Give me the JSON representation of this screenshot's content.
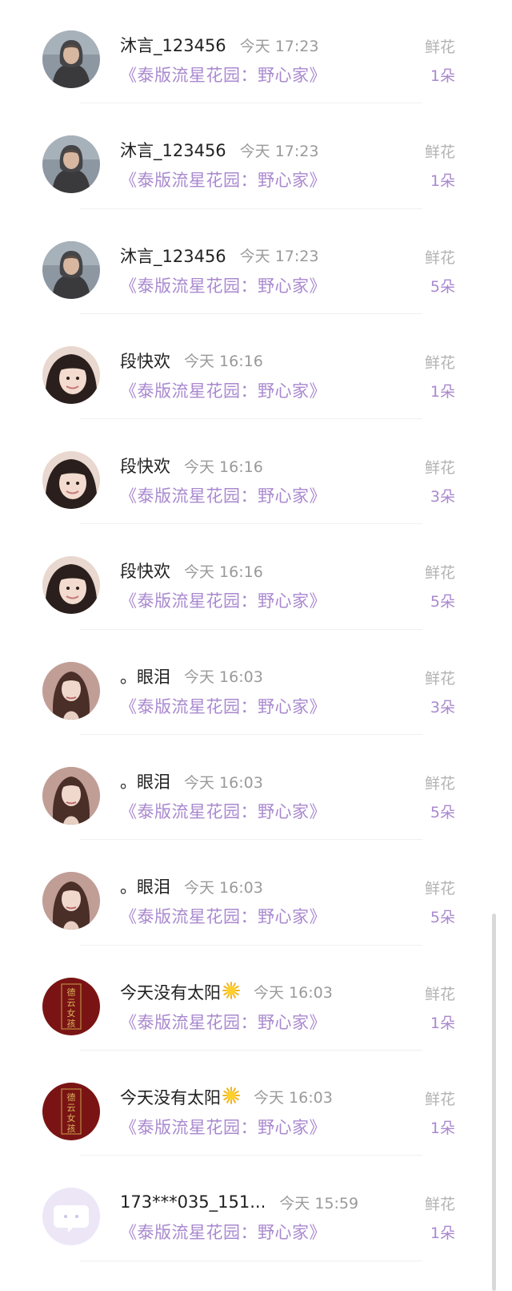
{
  "rows": [
    {
      "name": "沐言_123456",
      "time": "今天 17:23",
      "book": "《泰版流星花园：野心家》",
      "gift": "鲜花",
      "count": "1朵",
      "avatar": "avatar-hoodie"
    },
    {
      "name": "沐言_123456",
      "time": "今天 17:23",
      "book": "《泰版流星花园：野心家》",
      "gift": "鲜花",
      "count": "1朵",
      "avatar": "avatar-hoodie"
    },
    {
      "name": "沐言_123456",
      "time": "今天 17:23",
      "book": "《泰版流星花园：野心家》",
      "gift": "鲜花",
      "count": "5朵",
      "avatar": "avatar-hoodie"
    },
    {
      "name": "段快欢",
      "time": "今天 16:16",
      "book": "《泰版流星花园：野心家》",
      "gift": "鲜花",
      "count": "1朵",
      "avatar": "avatar-girl-bangs"
    },
    {
      "name": "段快欢",
      "time": "今天 16:16",
      "book": "《泰版流星花园：野心家》",
      "gift": "鲜花",
      "count": "3朵",
      "avatar": "avatar-girl-bangs"
    },
    {
      "name": "段快欢",
      "time": "今天 16:16",
      "book": "《泰版流星花园：野心家》",
      "gift": "鲜花",
      "count": "5朵",
      "avatar": "avatar-girl-bangs"
    },
    {
      "name": "。眼泪",
      "time": "今天 16:03",
      "book": "《泰版流星花园：野心家》",
      "gift": "鲜花",
      "count": "3朵",
      "avatar": "avatar-girl-longhair"
    },
    {
      "name": "。眼泪",
      "time": "今天 16:03",
      "book": "《泰版流星花园：野心家》",
      "gift": "鲜花",
      "count": "5朵",
      "avatar": "avatar-girl-longhair"
    },
    {
      "name": "。眼泪",
      "time": "今天 16:03",
      "book": "《泰版流星花园：野心家》",
      "gift": "鲜花",
      "count": "5朵",
      "avatar": "avatar-girl-longhair"
    },
    {
      "name": "今天没有太阳",
      "time": "今天 16:03",
      "book": "《泰版流星花园：野心家》",
      "gift": "鲜花",
      "count": "1朵",
      "avatar": "avatar-red-calligraphy",
      "emoji": "sun-icon",
      "seal_text": "德云女孩"
    },
    {
      "name": "今天没有太阳",
      "time": "今天 16:03",
      "book": "《泰版流星花园：野心家》",
      "gift": "鲜花",
      "count": "1朵",
      "avatar": "avatar-red-calligraphy",
      "emoji": "sun-icon",
      "seal_text": "德云女孩"
    },
    {
      "name": "173***035_151...",
      "time": "今天 15:59",
      "book": "《泰版流星花园：野心家》",
      "gift": "鲜花",
      "count": "1朵",
      "avatar": "avatar-default-chat"
    }
  ],
  "colors": {
    "accent": "#a989cf",
    "name": "#222222",
    "muted": "#9a9a9a",
    "gift_label": "#b3b3b3",
    "divider": "#f0f0f0",
    "scrollbar": "#d9d9d9"
  }
}
